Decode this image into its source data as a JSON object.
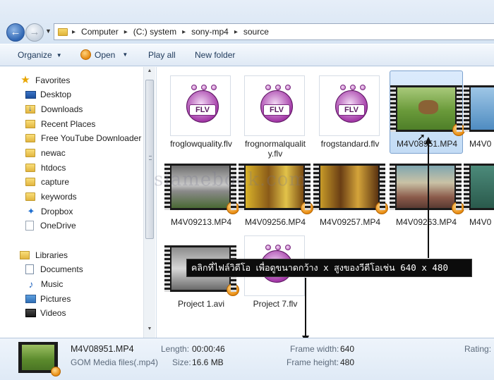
{
  "address": {
    "crumbs": [
      "Computer",
      "(C:) system",
      "sony-mp4",
      "source"
    ]
  },
  "toolbar": {
    "organize": "Organize",
    "open": "Open",
    "play_all": "Play all",
    "new_folder": "New folder"
  },
  "nav": {
    "favorites": "Favorites",
    "desktop": "Desktop",
    "downloads": "Downloads",
    "recent": "Recent Places",
    "youtube": "Free YouTube Downloader",
    "newac": "newac",
    "htdocs": "htdocs",
    "capture": "capture",
    "keywords": "keywords",
    "dropbox": "Dropbox",
    "onedrive": "OneDrive",
    "libraries": "Libraries",
    "documents": "Documents",
    "music": "Music",
    "pictures": "Pictures",
    "videos": "Videos"
  },
  "files": {
    "f1": "froglowquality.flv",
    "f2a": "frognormalqualit",
    "f2b": "y.flv",
    "f3": "frogstandard.flv",
    "f4": "M4V08951.MP4",
    "f5": "M4V0",
    "f6": "M4V09213.MP4",
    "f7": "M4V09256.MP4",
    "f8": "M4V09257.MP4",
    "f9": "M4V09263.MP4",
    "f10": "M4V0",
    "f11": "Project 1.avi",
    "f12": "Project 7.flv"
  },
  "flv_label": "FLV",
  "annotation": "คลิกที่ไฟล์วิดีโอ เพื่อดูขนาดกว้าง x สูงของวีดีโอเช่น 640 x 480",
  "watermark": "siamebook.com",
  "details": {
    "name": "M4V08951.MP4",
    "type": "GOM Media files(.mp4)",
    "length_label": "Length:",
    "length": "00:00:46",
    "size_label": "Size:",
    "size": "16.6 MB",
    "fw_label": "Frame width:",
    "fw": "640",
    "fh_label": "Frame height:",
    "fh": "480",
    "rating_label": "Rating:"
  },
  "colors": {
    "selection": "#c3dcf5",
    "callout_bg": "#0c0c0c",
    "flv_purple": "#a43aa8",
    "gom_orange": "#e88b10"
  }
}
